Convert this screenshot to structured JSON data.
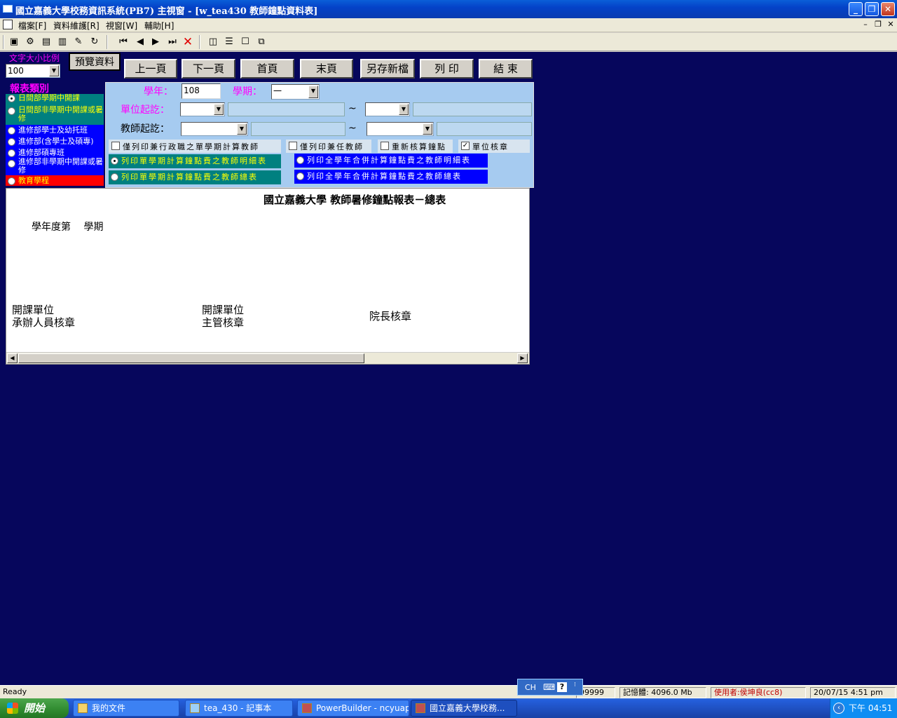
{
  "window": {
    "title": "國立嘉義大學校務資訊系統(PB7) 主視窗 - [w_tea430 教師鐘點資料表]"
  },
  "menu": {
    "items": [
      "檔案[F]",
      "資料維護[R]",
      "視窗[W]",
      "輔助[H]"
    ]
  },
  "toolbar": {
    "icons": [
      "save-icon",
      "tools-icon",
      "chart-icon",
      "print-icon",
      "eraser-icon",
      "refresh-icon",
      "first-icon",
      "prev-icon",
      "next-icon",
      "last-icon",
      "close-icon",
      "tile-vertical-icon",
      "tile-horizontal-icon",
      "maximize-icon",
      "cascade-icon"
    ]
  },
  "zoom": {
    "label": "文字大小比例",
    "value": "100"
  },
  "buttons": {
    "preview": "預覽資料",
    "prev_page": "上一頁",
    "next_page": "下一頁",
    "first_page": "首頁",
    "last_page": "末頁",
    "save_as": "另存新檔",
    "print": "列 印",
    "exit": "結 束"
  },
  "report_category": {
    "title": "報表類別",
    "items": [
      {
        "label": "日間部學期中開課",
        "selected": true,
        "color": "#008080",
        "text_color": "#ffff00"
      },
      {
        "label": "日間部非學期中開課或暑修",
        "selected": false,
        "color": "#008080",
        "text_color": "#ffff00"
      },
      {
        "label": "進修部學士及幼托班",
        "selected": false,
        "color": "#0000ff",
        "text_color": "#ffffff"
      },
      {
        "label": "進修部(含學士及碩專)",
        "selected": false,
        "color": "#0000ff",
        "text_color": "#ffffff"
      },
      {
        "label": "進修部碩專班",
        "selected": false,
        "color": "#0000ff",
        "text_color": "#ffffff"
      },
      {
        "label": "進修部非學期中開課或暑修",
        "selected": false,
        "color": "#0000ff",
        "text_color": "#ffffff"
      },
      {
        "label": "教育學程",
        "selected": false,
        "color": "#ff0000",
        "text_color": "#ffff00"
      }
    ]
  },
  "filters": {
    "year_label": "學年：",
    "year_value": "108",
    "term_label": "學期：",
    "term_value": "一",
    "unit_label": "單位起訖：",
    "teacher_label": "教師起訖：",
    "tilde": "~"
  },
  "checkboxes": {
    "admin_only": {
      "label": "僅列印兼行政職之單學期計算教師",
      "checked": false
    },
    "fulltime_only": {
      "label": "僅列印兼任教師",
      "checked": false
    },
    "recalc": {
      "label": "重新核算鐘點",
      "checked": false
    },
    "unit_stamp": {
      "label": "單位核章",
      "checked": true
    }
  },
  "options": {
    "single_detail": {
      "label": "列印單學期計算鐘點費之教師明細表",
      "selected": true
    },
    "single_summary": {
      "label": "列印單學期計算鐘點費之教師總表",
      "selected": false
    },
    "year_detail": {
      "label": "列印全學年合併計算鐘點費之教師明細表",
      "selected": false
    },
    "year_summary": {
      "label": "列印全學年合併計算鐘點費之教師總表",
      "selected": false
    }
  },
  "report": {
    "title": "國立嘉義大學 教師暑修鐘點報表－總表",
    "year_term": "學年度第　 學期",
    "sig1_line1": "開課單位",
    "sig1_line2": "承辦人員核章",
    "sig2_line1": "開課單位",
    "sig2_line2": "主管核章",
    "sig3": "院長核章"
  },
  "status": {
    "ready": "Ready",
    "code": "99999",
    "memory": "記憶體: 4096.0 Mb",
    "user": "使用者:侯坤良(cc8)",
    "datetime": "20/07/15 4:51 pm"
  },
  "ime": {
    "lang": "CH"
  },
  "taskbar": {
    "start": "開始",
    "tasks": [
      {
        "label": "我的文件",
        "active": false
      },
      {
        "label": "tea_430 - 記事本",
        "active": false
      },
      {
        "label": "PowerBuilder - ncyuapp",
        "active": false
      },
      {
        "label": "國立嘉義大學校務...",
        "active": true
      }
    ],
    "clock": "下午 04:51"
  },
  "colors": {
    "mdi_background": "#06065c",
    "panel": "#a6cbf0",
    "label_magenta": "#ff00ff"
  }
}
